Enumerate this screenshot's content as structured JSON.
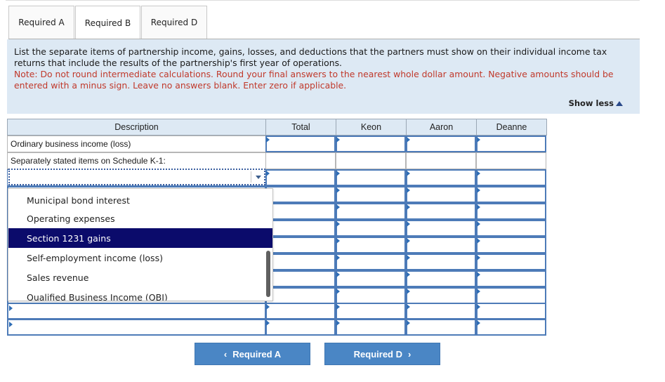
{
  "tabs": [
    {
      "label": "Required A",
      "active": false
    },
    {
      "label": "Required B",
      "active": true
    },
    {
      "label": "Required D",
      "active": false
    }
  ],
  "instructions": {
    "text": "List the separate items of partnership income, gains, losses, and deductions that the partners must show on their individual income tax returns that include the results of the partnership's first year of operations.",
    "note": "Note: Do not round intermediate calculations. Round your final answers to the nearest whole dollar amount. Negative amounts should be entered with a minus sign. Leave no answers blank. Enter zero if applicable."
  },
  "show_less": "Show less",
  "table": {
    "headers": [
      "Description",
      "Total",
      "Keon",
      "Aaron",
      "Deanne"
    ],
    "rows": [
      {
        "description": "Ordinary business income (loss)"
      },
      {
        "description": "Separately stated items on Schedule K-1:"
      }
    ]
  },
  "dropdown": {
    "selected_value": "",
    "options": [
      {
        "label": "Municipal bond interest",
        "selected": false
      },
      {
        "label": "Operating expenses",
        "selected": false
      },
      {
        "label": "Section 1231 gains",
        "selected": true
      },
      {
        "label": "Self-employment income (loss)",
        "selected": false
      },
      {
        "label": "Sales revenue",
        "selected": false
      },
      {
        "label": "Qualified Business Income (QBI)",
        "selected": false
      }
    ]
  },
  "nav": {
    "prev_label": "Required A",
    "next_label": "Required D"
  },
  "colors": {
    "panel_bg": "#dde9f4",
    "note_red": "#c0392b",
    "button_blue": "#4a86c5",
    "selected_option": "#0b0b6b"
  }
}
